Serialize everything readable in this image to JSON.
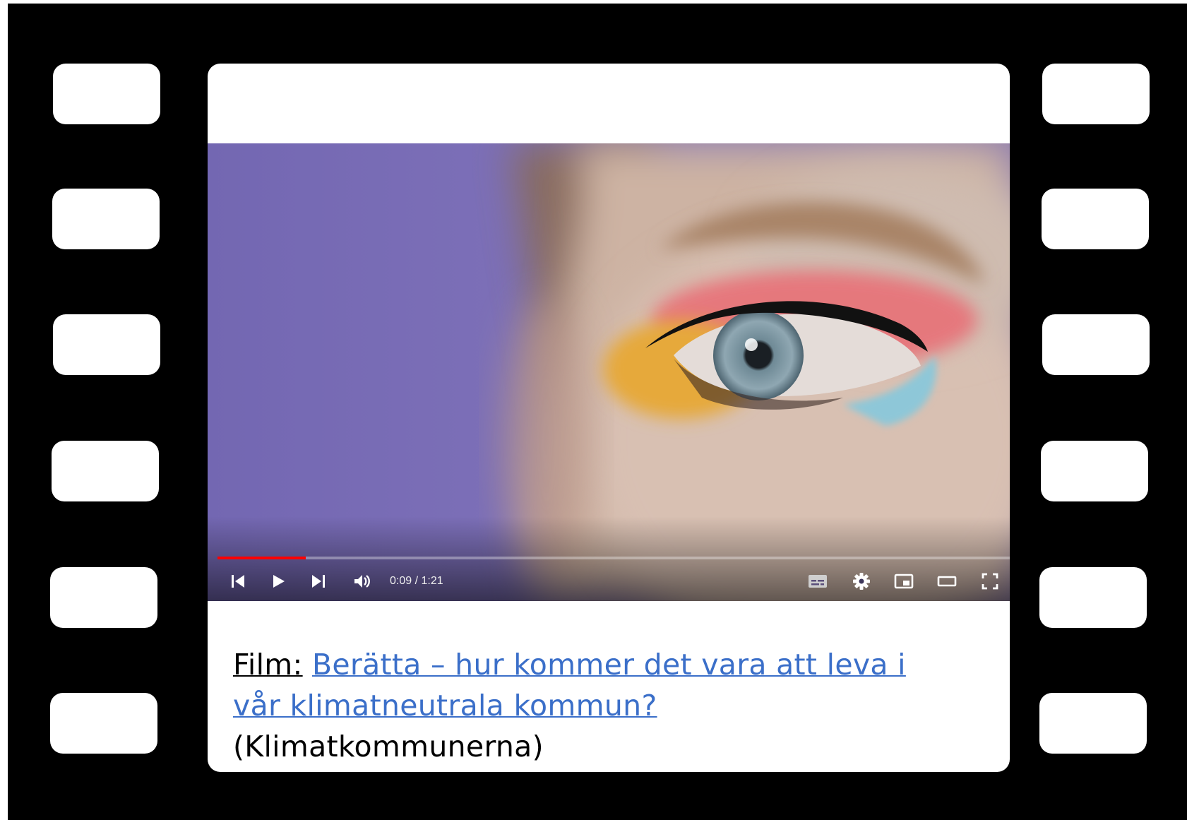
{
  "player": {
    "current_time": "0:09",
    "separator": " / ",
    "duration": "1:21",
    "progress": 0.111,
    "colors": {
      "played": "#ff0000",
      "background": "#7a6db6"
    },
    "controls": {
      "left": [
        "previous-icon",
        "play-icon",
        "next-icon",
        "volume-icon"
      ],
      "right": [
        "subtitles-icon",
        "settings-gear-icon",
        "miniplayer-icon",
        "theater-mode-icon",
        "fullscreen-icon"
      ]
    }
  },
  "caption": {
    "label": "Film:",
    "link_text": "Berätta – hur kommer det vara att leva i vår klimatneutrala kommun?",
    "source": "(Klimatkommunerna)",
    "link_color": "#3b6fc9"
  }
}
